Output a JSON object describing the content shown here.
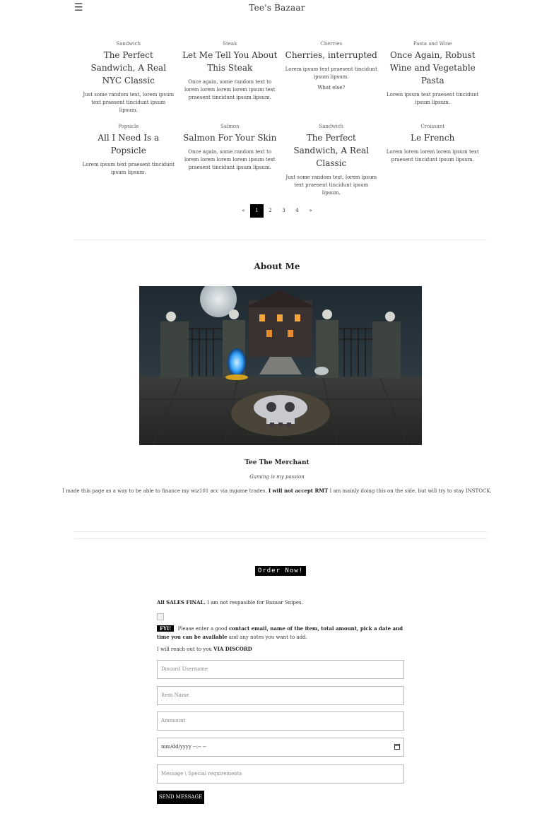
{
  "header": {
    "menu_icon": "☰",
    "title": "Tee's Bazaar"
  },
  "posts": [
    {
      "alt": "Sandwich",
      "title": "The Perfect Sandwich, A Real NYC Classic",
      "desc": "Just some random text, lorem ipsum text praesent tincidunt ipsum lipsum.",
      "extra": ""
    },
    {
      "alt": "Steak",
      "title": "Let Me Tell You About This Steak",
      "desc": "Once again, some random text to lorem lorem lorem lorem ipsum text praesent tincidunt ipsum lipsum.",
      "extra": ""
    },
    {
      "alt": "Cherries",
      "title": "Cherries, interrupted",
      "desc": "Lorem ipsum text praesent tincidunt ipsum lipsum.",
      "extra": "What else?"
    },
    {
      "alt": "Pasta and Wine",
      "title": "Once Again, Robust Wine and Vegetable Pasta",
      "desc": "Lorem ipsum text praesent tincidunt ipsum lipsum.",
      "extra": ""
    },
    {
      "alt": "Popsicle",
      "title": "All I Need Is a Popsicle",
      "desc": "Lorem ipsum text praesent tincidunt ipsum lipsum.",
      "extra": ""
    },
    {
      "alt": "Salmon",
      "title": "Salmon For Your Skin",
      "desc": "Once again, some random text to lorem lorem lorem lorem ipsum text praesent tincidunt ipsum lipsum.",
      "extra": ""
    },
    {
      "alt": "Sandwich",
      "title": "The Perfect Sandwich, A Real Classic",
      "desc": "Just some random text, lorem ipsum text praesent tincidunt ipsum lipsum.",
      "extra": ""
    },
    {
      "alt": "Croissant",
      "title": "Le French",
      "desc": "Lorem lorem lorem lorem ipsum text praesent tincidunt ipsum lipsum.",
      "extra": ""
    }
  ],
  "pagination": {
    "prev": "«",
    "pages": [
      "1",
      "2",
      "3",
      "4"
    ],
    "active": "1",
    "next": "»"
  },
  "about": {
    "title": "About Me",
    "name": "Tee The Merchant",
    "tagline": "Gaming is my passion",
    "bio_pre": "I made this page as a way to be able to finance my wiz101 acc via ingame trades.",
    "bio_bold": "I will not accept RMT",
    "bio_post": "I am mainly doing this on the side, but will try to stay INSTOCK."
  },
  "order": {
    "badge": "Order Now!",
    "final_bold": "All SALES FINAL.",
    "final_rest": "I am not respasible for Bazaar Snipes.",
    "fyi": "FYI!",
    "fyi_pre": "Please enter a good",
    "fyi_bold": "contact email, name of the item, total amount, pick a date and time you can be available",
    "fyi_post": "and any notes you want to add.",
    "reach_pre": "I will reach out to you",
    "reach_bold": "VIA DISCORD",
    "fields": {
      "discord": "Discord Username",
      "item": "Item Name",
      "amount": "Ammount",
      "date": "mm/dd/yyyy --:-- --",
      "message": "Message \\ Special requirements"
    },
    "send": "SEND MESSAGE"
  }
}
